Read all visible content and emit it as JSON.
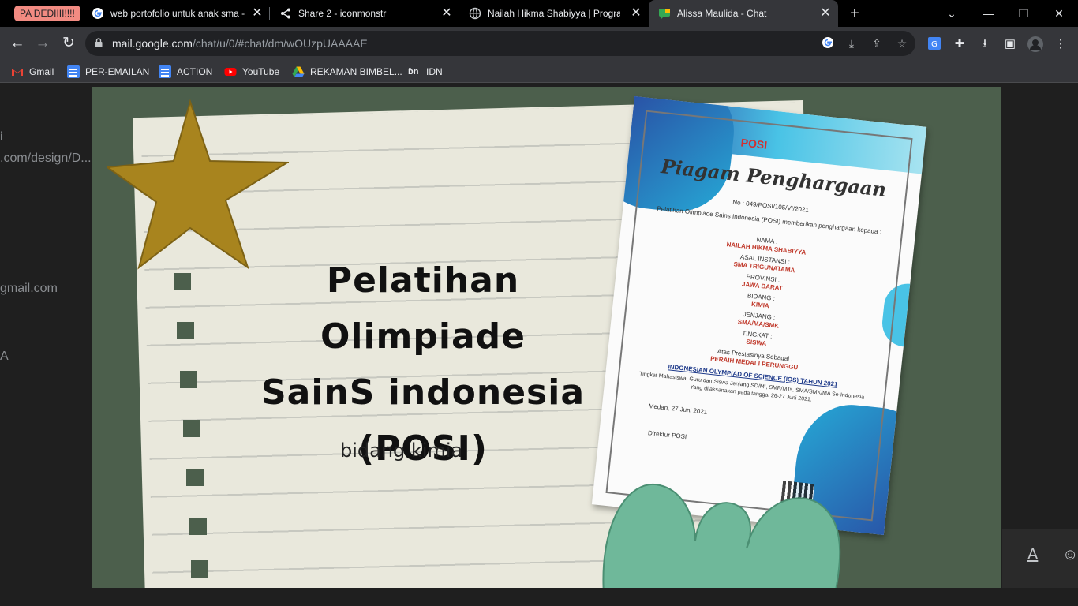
{
  "tab_group": {
    "label": "PA DEDIIII!!!!"
  },
  "tabs": [
    {
      "title": "web portofolio untuk anak sma -",
      "icon": "google-icon"
    },
    {
      "title": "Share 2 - iconmonstr",
      "icon": "share-icon"
    },
    {
      "title": "Nailah Hikma Shabiyya | Program",
      "icon": "globe-icon"
    },
    {
      "title": "Alissa Maulida - Chat",
      "icon": "google-chat-icon",
      "active": true
    }
  ],
  "address_bar": {
    "host": "mail.google.com",
    "path": "/chat/u/0/#chat/dm/wOUzpUAAAAE"
  },
  "bookmarks": [
    {
      "label": "Gmail",
      "icon": "gmail-icon"
    },
    {
      "label": "PER-EMAILAN",
      "icon": "docs-icon"
    },
    {
      "label": "ACTION",
      "icon": "docs-icon"
    },
    {
      "label": "YouTube",
      "icon": "youtube-icon"
    },
    {
      "label": "REKAMAN BIMBEL...",
      "icon": "drive-icon"
    },
    {
      "label": "IDN",
      "icon": "idn-icon"
    }
  ],
  "background_text": {
    "line1": "i",
    "line2": ".com/design/D...",
    "line3": "gmail.com",
    "line4": "A"
  },
  "slide": {
    "title_line1": "Pelatihan Olimpiade",
    "title_line2": "SainS indonesia",
    "title_line3": "(POSI)",
    "subtitle": "bidang kimia"
  },
  "certificate": {
    "logo": "POSI",
    "title": "Piagam Penghargaan",
    "number": "No : 049/POSI/105/VI/2021",
    "intro": "Pelatihan Olimpiade Sains Indonesia (POSI) memberikan penghargaan kepada :",
    "fields": [
      {
        "label": "NAMA :",
        "value": "NAILAH HIKMA SHABIYYA"
      },
      {
        "label": "ASAL INSTANSI :",
        "value": "SMA TRIGUNATAMA"
      },
      {
        "label": "PROVINSI :",
        "value": "JAWA BARAT"
      },
      {
        "label": "BIDANG :",
        "value": "KIMIA"
      },
      {
        "label": "JENJANG :",
        "value": "SMA/MA/SMK"
      },
      {
        "label": "TINGKAT :",
        "value": "SISWA"
      }
    ],
    "achievement_label": "Atas Prestasinya Sebagai :",
    "achievement": "PERAIH MEDALI PERUNGGU",
    "event": "INDONESIAN OLYMPIAD OF SCIENCE (IOS) TAHUN 2021",
    "desc1": "Tingkat Mahasiswa, Guru dan Siswa Jenjang SD/MI, SMP/MTs, SMA/SMK/MA Se-Indonesia",
    "desc2": "Yang dilaksanakan pada tanggal 26-27 Juni 2021.",
    "place_date": "Medan, 27 Juni 2021",
    "signatory": "Direktur POSI"
  },
  "colors": {
    "tab_group": "#f28b82",
    "slide_bg": "#4c5f4c",
    "star": "#a8841e",
    "cactus": "#6fb89a"
  }
}
